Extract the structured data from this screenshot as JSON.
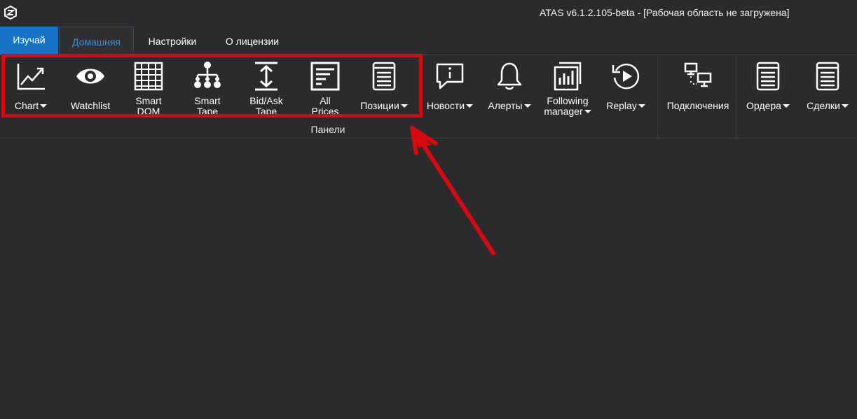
{
  "window": {
    "title": "ATAS v6.1.2.105-beta - [Рабочая область не загружена]"
  },
  "tabs": [
    {
      "label": "Изучай",
      "active": false
    },
    {
      "label": "Домашняя",
      "active": true
    },
    {
      "label": "Настройки",
      "active": false
    },
    {
      "label": "О лицензии",
      "active": false
    }
  ],
  "ribbon": {
    "panels_group_label": "Панели",
    "buttons": [
      {
        "label1": "Chart",
        "label2": "",
        "dropdown": true,
        "icon": "chart-line-icon"
      },
      {
        "label1": "Watchlist",
        "label2": "",
        "dropdown": false,
        "icon": "eye-icon"
      },
      {
        "label1": "Smart",
        "label2": "DOM",
        "dropdown": false,
        "icon": "grid-table-icon"
      },
      {
        "label1": "Smart",
        "label2": "Tape",
        "dropdown": false,
        "icon": "hierarchy-icon"
      },
      {
        "label1": "Bid/Ask",
        "label2": "Tape",
        "dropdown": false,
        "icon": "vertical-arrows-icon"
      },
      {
        "label1": "All",
        "label2": "Prices",
        "dropdown": false,
        "icon": "list-lines-icon"
      },
      {
        "label1": "Позиции",
        "label2": "",
        "dropdown": true,
        "icon": "document-icon"
      },
      {
        "label1": "Новости",
        "label2": "",
        "dropdown": true,
        "icon": "chat-info-icon"
      },
      {
        "label1": "Алерты",
        "label2": "",
        "dropdown": true,
        "icon": "bell-icon"
      },
      {
        "label1": "Following",
        "label2": "manager",
        "dropdown": true,
        "icon": "bar-chart-icon"
      },
      {
        "label1": "Replay",
        "label2": "",
        "dropdown": true,
        "icon": "replay-icon"
      },
      {
        "label1": "Подключения",
        "label2": "",
        "dropdown": false,
        "icon": "network-icon"
      },
      {
        "label1": "Ордера",
        "label2": "",
        "dropdown": true,
        "icon": "document-icon"
      },
      {
        "label1": "Сделки",
        "label2": "",
        "dropdown": true,
        "icon": "document-icon"
      }
    ]
  },
  "colors": {
    "background": "#2b2b2d",
    "accent_tab": "#1673c8",
    "active_tab_text": "#3a8fd8",
    "highlight": "#d8090f"
  }
}
